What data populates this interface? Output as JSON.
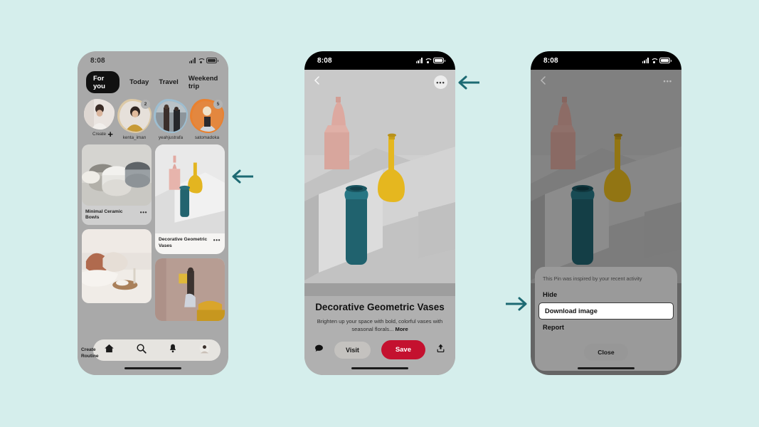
{
  "background_color": "#d5eeec",
  "arrow_color": "#1d6a73",
  "arrows": [
    {
      "name": "arrow-to-pin-card",
      "direction": "left",
      "glyph": "←"
    },
    {
      "name": "arrow-to-overflow-menu",
      "direction": "left",
      "glyph": "←"
    },
    {
      "name": "arrow-to-download-image",
      "direction": "right",
      "glyph": "→"
    }
  ],
  "phone1": {
    "status": {
      "time": "8:08",
      "signal": "signal-bars-icon",
      "wifi": "wifi-icon",
      "battery": "battery-icon"
    },
    "tabs": [
      {
        "label": "For you",
        "selected": true
      },
      {
        "label": "Today",
        "selected": false
      },
      {
        "label": "Travel",
        "selected": false
      },
      {
        "label": "Weekend trip",
        "selected": false
      }
    ],
    "stories": [
      {
        "label": "Create",
        "badge": "",
        "plus": "+",
        "ring": "none",
        "skin": "#efe9e6"
      },
      {
        "label": "kenta_iman",
        "badge": "2",
        "plus": "",
        "ring": "#d9c9a8",
        "skin": "#cfa85e"
      },
      {
        "label": "yeahjustrafa",
        "badge": "",
        "plus": "",
        "ring": "#9bbdd0",
        "skin": "#6e7b85"
      },
      {
        "label": "satomadoka",
        "badge": "5",
        "plus": "",
        "ring": "#e97f2e",
        "skin": "#e2874a"
      }
    ],
    "pins": [
      {
        "title": "Minimal Ceramic Bowls",
        "more": "•••",
        "selected": false
      },
      {
        "title": "Decorative Geometric Vases",
        "more": "•••",
        "selected": true
      },
      {
        "title": "",
        "more": "",
        "selected": false
      },
      {
        "title": "",
        "more": "",
        "selected": false
      }
    ],
    "create_routine_label": "Create Routine",
    "nav": [
      {
        "name": "nav-home",
        "icon": "home-icon"
      },
      {
        "name": "nav-search",
        "icon": "search-icon"
      },
      {
        "name": "nav-notifications",
        "icon": "bell-icon"
      },
      {
        "name": "nav-profile",
        "icon": "avatar-icon"
      }
    ]
  },
  "phone2": {
    "status": {
      "time": "8:08"
    },
    "back_icon": "chevron-left-icon",
    "menu_icon": "ellipsis-icon",
    "menu_glyph": "•••",
    "lens_icon": "visual-search-icon",
    "title": "Decorative Geometric Vases",
    "description": "Brighten up your space with bold, colorful vases with seasonal florals...",
    "more_label": "More",
    "comment_icon": "comment-icon",
    "visit_label": "Visit",
    "save_label": "Save",
    "share_icon": "share-icon",
    "save_color": "#c4112f"
  },
  "phone3": {
    "status": {
      "time": "8:08"
    },
    "back_icon": "chevron-left-icon",
    "menu_glyph": "•••",
    "sheet": {
      "note": "This Pin was inspired by your recent activity",
      "items": [
        {
          "label": "Hide",
          "highlighted": false
        },
        {
          "label": "Download image",
          "highlighted": true
        },
        {
          "label": "Report",
          "highlighted": false
        }
      ],
      "close_label": "Close"
    }
  }
}
